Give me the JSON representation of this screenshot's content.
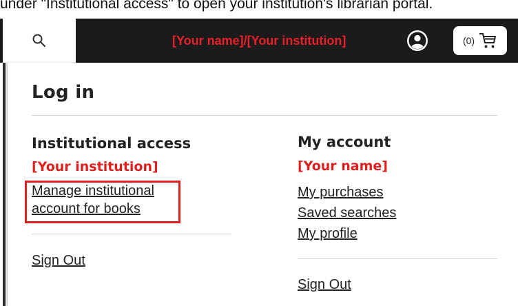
{
  "document": {
    "instruction_text": "under \"Institutional access\" to open your institution's librarian portal."
  },
  "header": {
    "user_label": "[Your name]/[Your institution]",
    "cart_count": "(0)",
    "colors": {
      "background": "#1b1b1b",
      "user_label": "#e8202a"
    }
  },
  "login_panel": {
    "title": "Log in",
    "institutional": {
      "heading": "Institutional access",
      "name": "[Your institution]",
      "manage_link_line1": "Manage institutional",
      "manage_link_line2": "account for books",
      "sign_out": "Sign Out"
    },
    "my_account": {
      "heading": "My account",
      "name": "[Your name]",
      "links": [
        "My purchases",
        "Saved searches",
        "My profile"
      ],
      "sign_out": "Sign Out"
    }
  },
  "icons": [
    "search-icon",
    "account-circle-icon",
    "cart-icon"
  ],
  "colors": {
    "accent_red": "#e0201f"
  }
}
